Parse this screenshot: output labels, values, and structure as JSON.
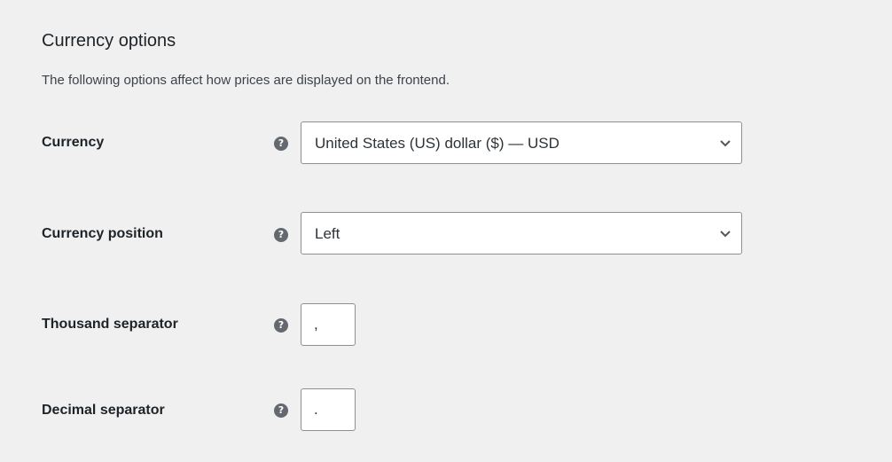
{
  "section": {
    "title": "Currency options",
    "description": "The following options affect how prices are displayed on the frontend."
  },
  "fields": {
    "currency": {
      "label": "Currency",
      "value": "United States (US) dollar ($) — USD",
      "help_icon": "question-circle-icon"
    },
    "currency_position": {
      "label": "Currency position",
      "value": "Left",
      "help_icon": "question-circle-icon"
    },
    "thousand_separator": {
      "label": "Thousand separator",
      "value": ",",
      "help_icon": "question-circle-icon"
    },
    "decimal_separator": {
      "label": "Decimal separator",
      "value": ".",
      "help_icon": "question-circle-icon"
    }
  },
  "help_glyph": "?",
  "colors": {
    "background": "#f0f0f1",
    "input_border": "#8c8f94",
    "help_icon": "#646970",
    "text": "#1d2327"
  }
}
